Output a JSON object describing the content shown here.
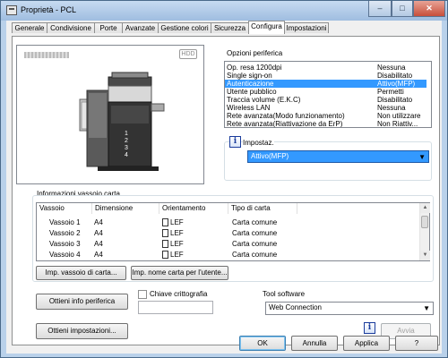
{
  "window": {
    "title": "Proprietà - PCL",
    "buttons": {
      "minimize": "–",
      "maximize": "□",
      "close": "✕"
    }
  },
  "tabs": [
    {
      "label": "Generale"
    },
    {
      "label": "Condivisione"
    },
    {
      "label": "Porte"
    },
    {
      "label": "Avanzate"
    },
    {
      "label": "Gestione colori"
    },
    {
      "label": "Sicurezza"
    },
    {
      "label": "Configura"
    },
    {
      "label": "Impostazioni"
    }
  ],
  "active_tab": "Configura",
  "preview": {
    "hdd_badge": "HDD",
    "tray_numbers": [
      "1",
      "2",
      "3",
      "4"
    ]
  },
  "options": {
    "group_label": "Opzioni periferica",
    "items": [
      {
        "name": "Op. resa 1200dpi",
        "value": "Nessuna"
      },
      {
        "name": "Single sign-on",
        "value": "Disabilitato"
      },
      {
        "name": "Autenticazione",
        "value": "Attivo(MFP)",
        "selected": true
      },
      {
        "name": "Utente pubblico",
        "value": "Permetti"
      },
      {
        "name": "Traccia volume (E.K.C)",
        "value": "Disabilitato"
      },
      {
        "name": "Wireless LAN",
        "value": "Nessuna"
      },
      {
        "name": "Rete avanzata(Modo funzionamento)",
        "value": "Non utilizzare"
      },
      {
        "name": "Rete avanzata(Riattivazione da ErP)",
        "value": "Non Riattiv..."
      }
    ],
    "setting_label": "Impostaz.",
    "setting_value": "Attivo(MFP)"
  },
  "tray_info": {
    "group_label": "Informazioni vassoio carta",
    "columns": [
      "Vassoio",
      "Dimensione",
      "Orientamento",
      "Tipo di carta"
    ],
    "rows": [
      {
        "tray": "Vassoio 1",
        "size": "A4",
        "orientation": "LEF",
        "type": "Carta comune"
      },
      {
        "tray": "Vassoio 2",
        "size": "A4",
        "orientation": "LEF",
        "type": "Carta comune"
      },
      {
        "tray": "Vassoio 3",
        "size": "A4",
        "orientation": "LEF",
        "type": "Carta comune"
      },
      {
        "tray": "Vassoio 4",
        "size": "A4",
        "orientation": "LEF",
        "type": "Carta comune"
      }
    ],
    "btn_tray_settings": "Imp. vassoio di carta...",
    "btn_paper_name": "Imp. nome carta per l'utente..."
  },
  "actions": {
    "get_device_info": "Ottieni info periferica",
    "encryption_key": "Chiave crittografia",
    "get_settings": "Ottieni impostazioni...",
    "software_tool_label": "Tool software",
    "software_tool_value": "Web Connection",
    "launch": "Avvia"
  },
  "footer": {
    "ok": "OK",
    "cancel": "Annulla",
    "apply": "Applica",
    "help": "?"
  }
}
